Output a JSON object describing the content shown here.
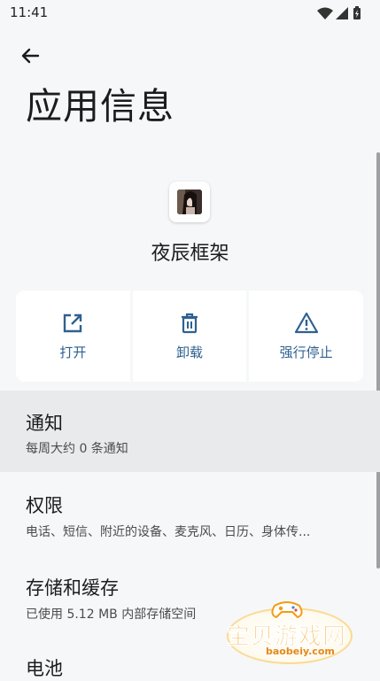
{
  "status_bar": {
    "time": "11:41"
  },
  "header": {
    "title": "应用信息"
  },
  "app": {
    "name": "夜辰框架"
  },
  "actions": [
    {
      "label": "打开",
      "icon": "open-external-icon"
    },
    {
      "label": "卸载",
      "icon": "trash-icon"
    },
    {
      "label": "强行停止",
      "icon": "warning-icon"
    }
  ],
  "settings": {
    "notifications": {
      "title": "通知",
      "summary": "每周大约 0 条通知"
    },
    "permissions": {
      "title": "权限",
      "summary": "电话、短信、附近的设备、麦克风、日历、身体传..."
    },
    "storage": {
      "title": "存储和缓存",
      "summary": "已使用 5.12 MB 内部存储空间"
    },
    "battery": {
      "title": "电池"
    }
  },
  "watermark": {
    "text": "宝贝游戏网",
    "domain": "baobeiy.com"
  },
  "colors": {
    "accent": "#2f6190",
    "background": "#f6f7f8",
    "watermark": "#f39c12"
  }
}
